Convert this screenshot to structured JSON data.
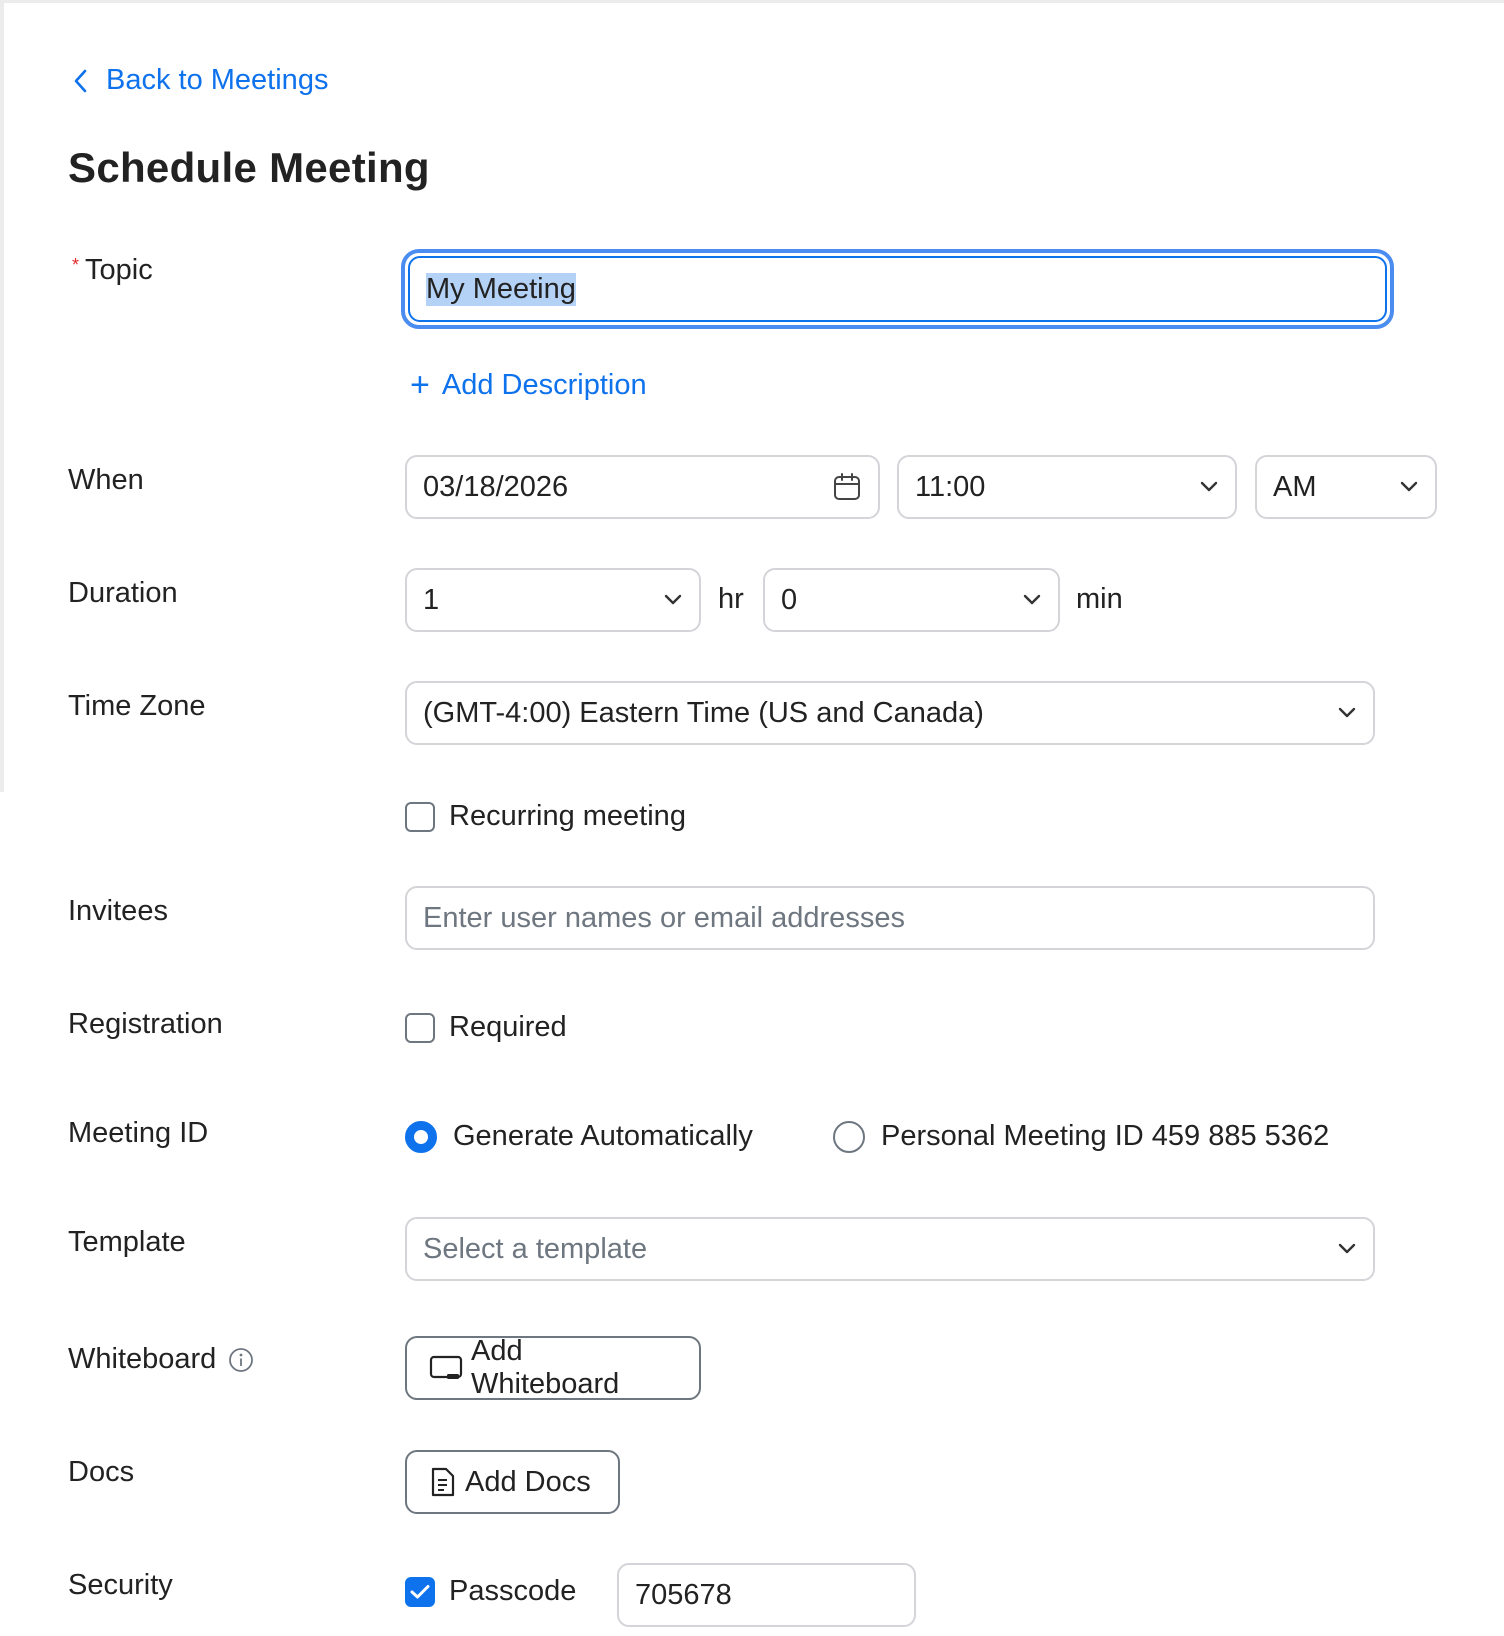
{
  "nav": {
    "back_label": "Back to Meetings"
  },
  "page": {
    "title": "Schedule Meeting"
  },
  "topic": {
    "label": "Topic",
    "value": "My Meeting",
    "add_description_label": "Add Description"
  },
  "when": {
    "label": "When",
    "date": "03/18/2026",
    "time": "11:00",
    "ampm": "AM"
  },
  "duration": {
    "label": "Duration",
    "hours": "1",
    "hours_unit": "hr",
    "minutes": "0",
    "minutes_unit": "min"
  },
  "timezone": {
    "label": "Time Zone",
    "value": "(GMT-4:00) Eastern Time (US and Canada)"
  },
  "recurring": {
    "label": "Recurring meeting",
    "checked": false
  },
  "invitees": {
    "label": "Invitees",
    "placeholder": "Enter user names or email addresses"
  },
  "registration": {
    "label": "Registration",
    "option_label": "Required",
    "checked": false
  },
  "meeting_id": {
    "label": "Meeting ID",
    "options": [
      {
        "label": "Generate Automatically",
        "selected": true
      },
      {
        "label": "Personal Meeting ID 459 885 5362",
        "selected": false
      }
    ]
  },
  "template": {
    "label": "Template",
    "placeholder": "Select a template"
  },
  "whiteboard": {
    "label": "Whiteboard",
    "button_label": "Add Whiteboard"
  },
  "docs": {
    "label": "Docs",
    "button_label": "Add Docs"
  },
  "security": {
    "label": "Security",
    "passcode_label": "Passcode",
    "passcode_checked": true,
    "passcode_value": "705678"
  },
  "colors": {
    "accent": "#0e72ed",
    "focus_ring": "#4a8cf0",
    "border": "#d4d4d9",
    "required": "#e02828"
  },
  "icons": [
    "chevron-left-icon",
    "plus-icon",
    "calendar-icon",
    "chevron-down-icon",
    "info-icon",
    "whiteboard-icon",
    "docs-icon",
    "checkmark-icon"
  ]
}
